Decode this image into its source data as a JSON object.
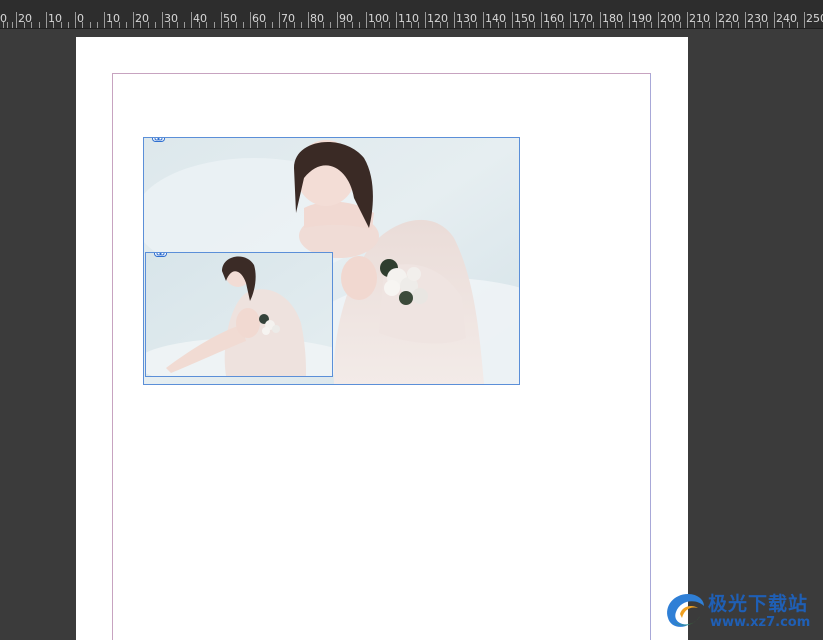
{
  "ruler": {
    "labels": [
      "0",
      "20",
      "10",
      "0",
      "10",
      "20",
      "30",
      "40",
      "50",
      "60",
      "70",
      "80",
      "90",
      "100",
      "110",
      "120",
      "130",
      "140",
      "150",
      "160",
      "170",
      "180",
      "190",
      "200",
      "210",
      "220",
      "230",
      "240",
      "250"
    ]
  },
  "frames": {
    "large": {
      "icon": "link-icon",
      "content": "photo-woman-white-dress-flowers"
    },
    "small": {
      "icon": "link-icon",
      "content": "photo-woman-white-dress-flowers"
    }
  },
  "watermark": {
    "brand": "极光下载站",
    "url": "www.xz7.com",
    "logo_icon": "swirl-logo-icon"
  },
  "colors": {
    "app_bg": "#3b3b3b",
    "ruler_bg": "#2d2d2d",
    "frame_border": "#5b8fd8",
    "margin_guide": "#c7a3c0",
    "watermark": "#1f5fb5"
  }
}
